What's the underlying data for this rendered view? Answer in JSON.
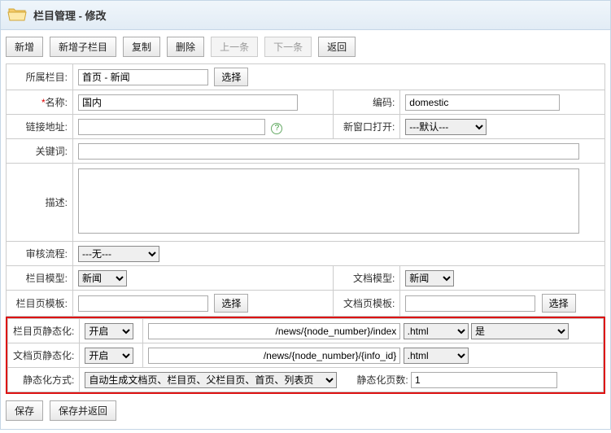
{
  "header": {
    "title": "栏目管理 - 修改"
  },
  "toolbar": {
    "new": "新增",
    "new_sub": "新增子栏目",
    "copy": "复制",
    "delete": "删除",
    "prev": "上一条",
    "next": "下一条",
    "back": "返回"
  },
  "labels": {
    "parent": "所属栏目:",
    "name": "名称:",
    "code": "编码:",
    "link": "链接地址:",
    "new_window": "新窗口打开:",
    "keywords": "关键词:",
    "description": "描述:",
    "workflow": "审核流程:",
    "node_model": "栏目模型:",
    "doc_model": "文档模型:",
    "node_tpl": "栏目页模板:",
    "doc_tpl": "文档页模板:",
    "node_static": "栏目页静态化:",
    "doc_static": "文档页静态化:",
    "static_method": "静态化方式:",
    "static_pages": "静态化页数:"
  },
  "buttons": {
    "select": "选择",
    "save": "保存",
    "save_back": "保存并返回"
  },
  "fields": {
    "parent": "首页 - 新闻",
    "name": "国内",
    "code": "domestic",
    "link": "",
    "new_window": "---默认---",
    "keywords": "",
    "description": "",
    "workflow": "---无---",
    "node_model": "新闻",
    "doc_model": "新闻",
    "node_tpl": "",
    "doc_tpl": "",
    "node_static_on": "开启",
    "node_static_path": "/news/{node_number}/index",
    "node_static_ext": ".html",
    "node_static_def": "是",
    "doc_static_on": "开启",
    "doc_static_path": "/news/{node_number}/{info_id}",
    "doc_static_ext": ".html",
    "static_method": "自动生成文档页、栏目页、父栏目页、首页、列表页",
    "static_pages": "1"
  }
}
